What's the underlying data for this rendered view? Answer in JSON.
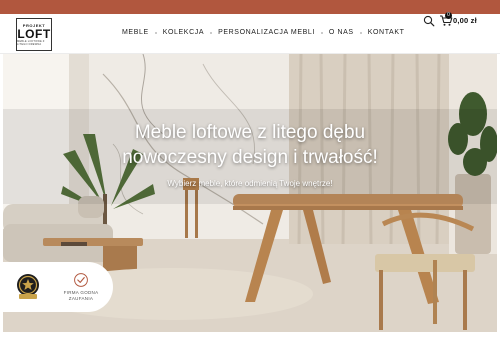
{
  "logo": {
    "top": "PROJEKT",
    "main": "LOFT",
    "tagline": "MEBLE LOFTOWE Z LITEGO DREWNA"
  },
  "nav": {
    "items": [
      "Meble",
      "Kolekcja",
      "Personalizacja mebli",
      "O nas",
      "Kontakt"
    ]
  },
  "header": {
    "search_icon": "search-icon",
    "cart_icon": "cart-icon",
    "cart_count": "0",
    "cart_total": "0,00 zł"
  },
  "hero": {
    "title_line1": "Meble loftowe z litego dębu",
    "title_line2": "nowoczesny design i trwałość!",
    "subtitle": "Wybierz meble, które odmienią Twoje wnętrze!"
  },
  "badges": {
    "seal_label": "seal",
    "trust_line1": "FIRMA GODNA",
    "trust_line2": "ZAUFANIA"
  },
  "colors": {
    "topbar": "#b1573e",
    "text": "#222222"
  }
}
